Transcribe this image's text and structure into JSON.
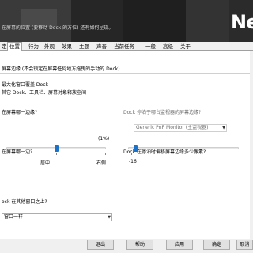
{
  "header": {
    "subtitle": "在屏幕的位置 (要移动 Dock 的方位) 还有如何呈现。",
    "logo": "Ne"
  },
  "tabs": [
    "定",
    "位置",
    "行为",
    "外观",
    "效果",
    "主题",
    "声音",
    "当前任务",
    "一般",
    "高级",
    "关于"
  ],
  "active_tab": 1,
  "content": {
    "edge_title": "屏幕边缘 (不会锁定在屏幕任何地方拖曳的手动的 Dock)",
    "maximize_title": "最大化窗口覆盖 Dock",
    "maximize_desc": "其它 Dock、工具栏、屏幕对象释放空间",
    "which_edge_label": "在屏幕哪一边缘?",
    "monitor_label": "Dock 停泊于哪台监视器的屏幕边缘?",
    "monitor_value": "Generic PnP Monitor (主监视器)",
    "position_label": "在屏幕哪一边?",
    "position_pct": "(1%)",
    "position_mid": "居中",
    "position_right": "右侧",
    "position_value_fraction": 0.5,
    "offset_label": "Dock 在停泊时偏移屏幕边缘多少像素?",
    "offset_value": "-16",
    "offset_fraction": 0.07,
    "layer_label": "ock 在其他窗口之上?",
    "layer_value": "窗口一样"
  },
  "footer": {
    "buttons": [
      "退出",
      "帮助",
      "应用",
      "确定",
      "取消"
    ]
  }
}
